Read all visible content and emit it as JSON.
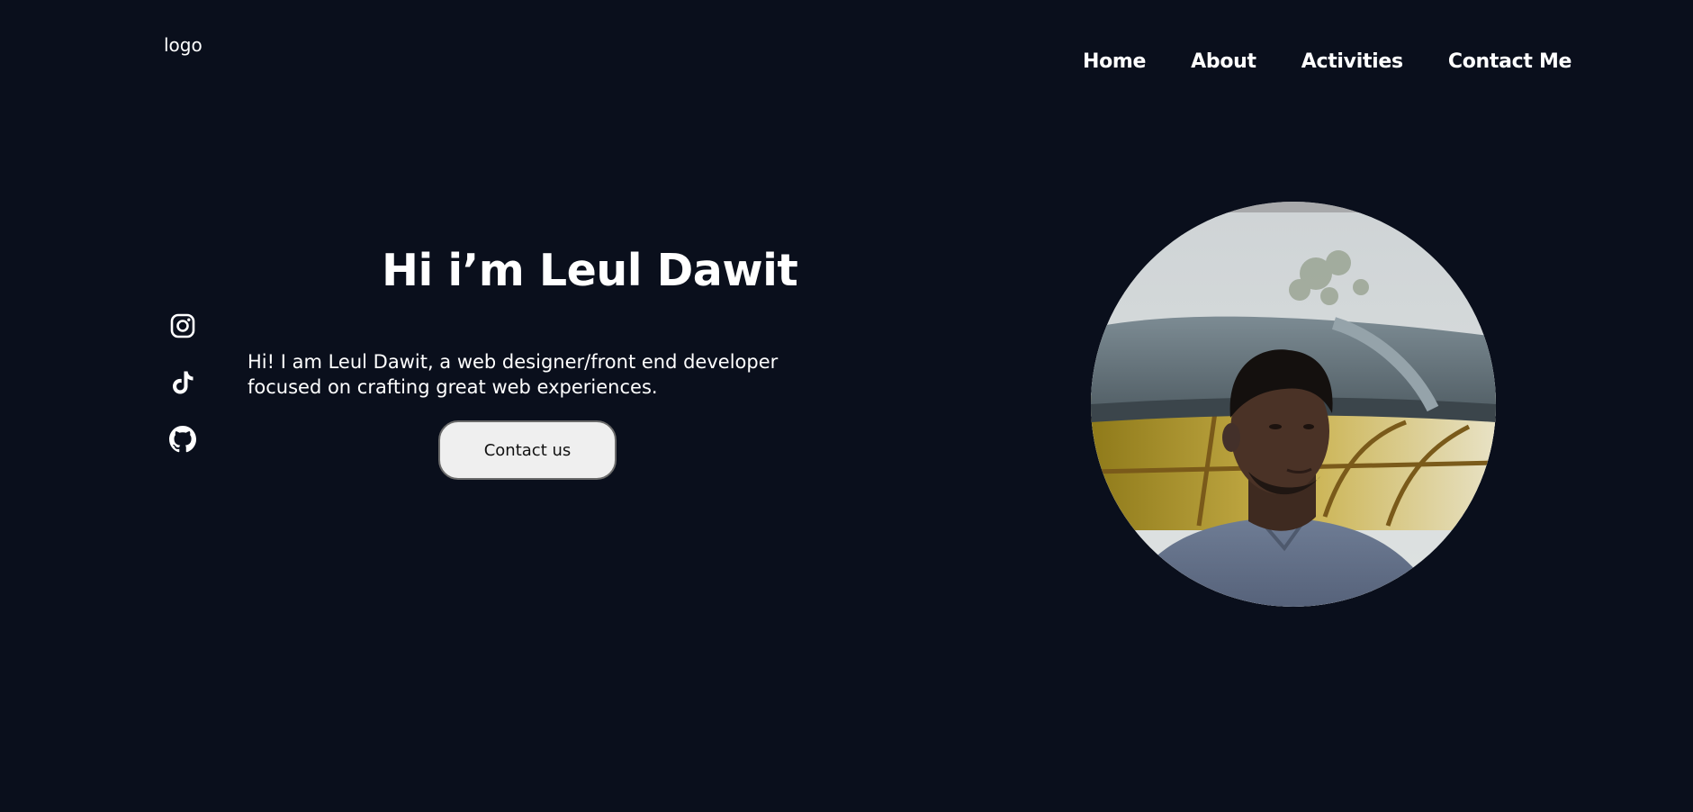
{
  "header": {
    "logo": "logo",
    "nav": [
      {
        "label": "Home"
      },
      {
        "label": "About"
      },
      {
        "label": "Activities"
      },
      {
        "label": "Contact Me"
      }
    ]
  },
  "socials": [
    {
      "icon": "instagram-icon"
    },
    {
      "icon": "tiktok-icon"
    },
    {
      "icon": "github-icon"
    }
  ],
  "hero": {
    "title": "Hi i’m Leul Dawit",
    "description": "Hi! I am Leul Dawit, a web designer/front end developer focused on crafting great web experiences.",
    "cta_label": "Contact us"
  },
  "colors": {
    "background": "#0a0f1c",
    "text": "#ffffff",
    "button_bg": "#efefef",
    "button_text": "#111111"
  }
}
